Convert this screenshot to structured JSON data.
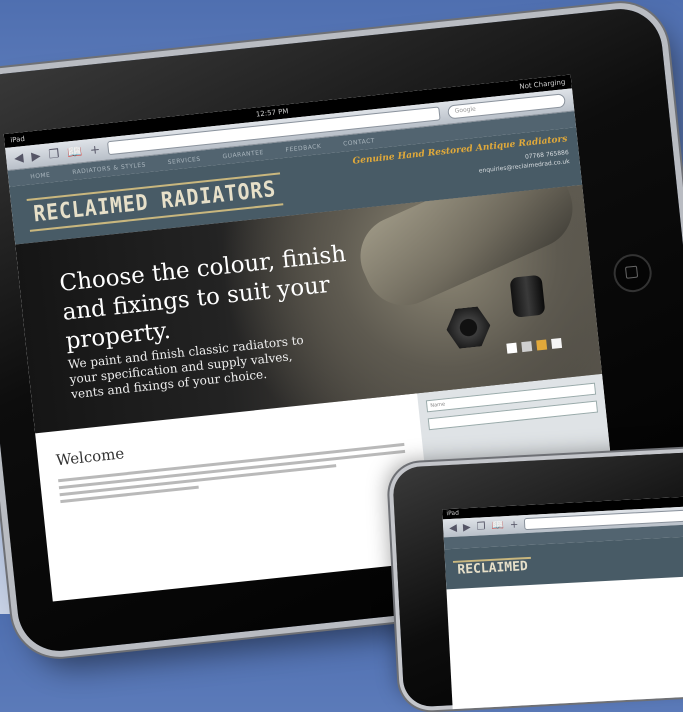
{
  "status": {
    "carrier": "iPad",
    "time": "12:57 PM",
    "battery": "Not Charging"
  },
  "browser": {
    "back": "◀",
    "forward": "▶",
    "tabs": "❐",
    "bookmarks": "📖",
    "add": "+",
    "search_placeholder": "Google"
  },
  "site": {
    "nav": [
      "HOME",
      "RADIATORS & STYLES",
      "SERVICES",
      "GUARANTEE",
      "FEEDBACK",
      "CONTACT"
    ],
    "logo": "RECLAIMED RADIATORS",
    "tagline": "Genuine Hand Restored Antique Radiators",
    "contact_lines": [
      "07768 765886",
      "enquiries@reclaimedrad.co.uk"
    ],
    "hero_heading": "Choose the colour, finish and fixings to suit your property.",
    "hero_text": "We paint and finish classic radiators to your specification and supply valves, vents and fixings of your choice.",
    "swatches": [
      "#ffffff",
      "#cfcfcf",
      "#e2a93a",
      "#f5f5f5"
    ],
    "welcome_title": "Welcome",
    "sidebox_field": "Name"
  },
  "mini": {
    "carrier": "iPad",
    "logo": "RECLAIMED"
  }
}
